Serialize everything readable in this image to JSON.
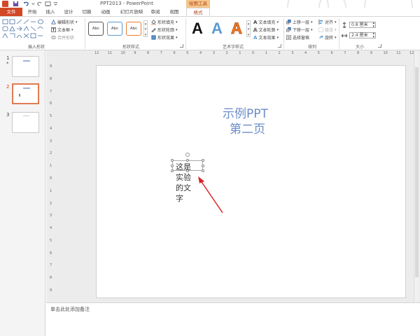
{
  "titlebar": {
    "title": "PPT2013 - PowerPoint",
    "context_tool": "绘图工具",
    "quick_access": [
      "save-icon",
      "undo-icon",
      "redo-icon",
      "start-slideshow-icon"
    ]
  },
  "tabs": {
    "file": "文件",
    "items": [
      "开始",
      "插入",
      "设计",
      "切换",
      "动画",
      "幻灯片放映",
      "审阅",
      "视图"
    ],
    "active": "格式"
  },
  "ribbon": {
    "insert_shapes": {
      "label": "插入形状",
      "edit_shape": "编辑形状",
      "text_box": "文本框",
      "merge_shapes": "合并形状"
    },
    "shape_styles": {
      "label": "形状样式",
      "style_samples": [
        "Abc",
        "Abc",
        "Abc"
      ],
      "fill": "形状填充",
      "outline": "形状轮廓",
      "effects": "形状效果"
    },
    "wordart_styles": {
      "label": "艺术字样式",
      "samples": [
        "A",
        "A",
        "A"
      ],
      "text_fill": "文本填充",
      "text_outline": "文本轮廓",
      "text_effects": "文本效果"
    },
    "arrange": {
      "label": "排列",
      "bring_forward": "上移一层",
      "send_backward": "下移一层",
      "selection_pane": "选择窗格",
      "align": "对齐",
      "group": "组合",
      "rotate": "旋转"
    },
    "size": {
      "label": "大小",
      "height": "0.8 厘米",
      "width": "2.4 厘米"
    }
  },
  "slides_pane": {
    "slides": [
      {
        "number": "1",
        "marker": "*"
      },
      {
        "number": "2",
        "marker": ""
      },
      {
        "number": "3",
        "marker": ""
      }
    ],
    "selected": "2"
  },
  "slide": {
    "title_line1": "示例PPT",
    "title_line2": "第二页",
    "vertical_text": [
      "这是",
      "实验",
      "的文",
      "字"
    ]
  },
  "rulers": {
    "horizontal": [
      "12",
      "11",
      "10",
      "9",
      "8",
      "7",
      "6",
      "5",
      "4",
      "3",
      "2",
      "1",
      "0",
      "1",
      "2",
      "3",
      "4",
      "5",
      "6",
      "7",
      "8",
      "9",
      "10",
      "11",
      "12"
    ],
    "vertical": [
      "9",
      "8",
      "7",
      "6",
      "5",
      "4",
      "3",
      "2",
      "1",
      "0",
      "1",
      "2",
      "3",
      "4",
      "5",
      "6",
      "7",
      "8",
      "9"
    ]
  },
  "notes": {
    "placeholder": "单击此处添加备注"
  },
  "colors": {
    "file_tab": "#d24726",
    "context_tab": "#f5c58a",
    "title_text": "#6b8cc9",
    "annotation_arrow": "#d9252a",
    "selected_thumbnail": "#e07b53"
  }
}
